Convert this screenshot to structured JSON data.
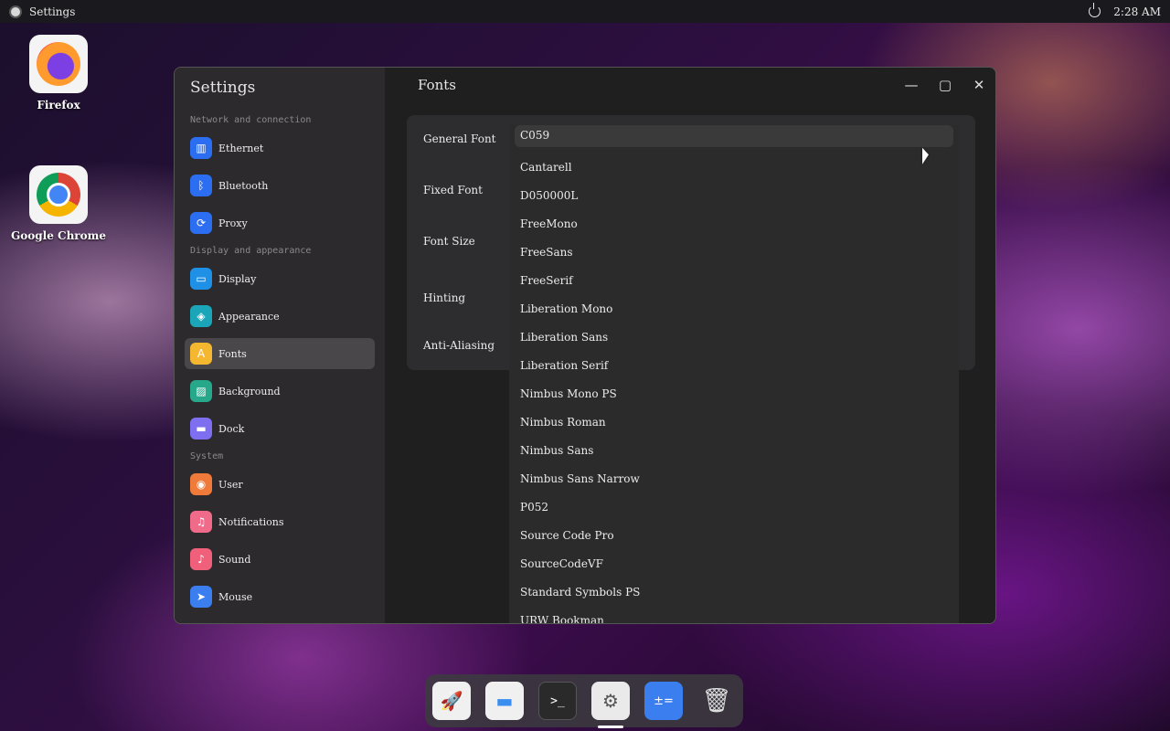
{
  "topbar": {
    "app_title": "Settings",
    "time": "2:28 AM"
  },
  "desktop": {
    "icons": [
      {
        "label": "Firefox"
      },
      {
        "label": "Google Chrome"
      }
    ]
  },
  "window": {
    "app_title": "Settings",
    "page_title": "Fonts",
    "sidebar": {
      "sections": [
        {
          "label": "Network and connection",
          "items": [
            {
              "label": "Ethernet",
              "icon": "ethernet-icon",
              "color": "#2b6ef2"
            },
            {
              "label": "Bluetooth",
              "icon": "bluetooth-icon",
              "color": "#2b6ef2"
            },
            {
              "label": "Proxy",
              "icon": "proxy-icon",
              "color": "#2b6ef2"
            }
          ]
        },
        {
          "label": "Display and appearance",
          "items": [
            {
              "label": "Display",
              "icon": "display-icon",
              "color": "#1e90e6"
            },
            {
              "label": "Appearance",
              "icon": "appearance-icon",
              "color": "#1aa6b8"
            },
            {
              "label": "Fonts",
              "icon": "fonts-icon",
              "color": "#f5b630",
              "active": true
            },
            {
              "label": "Background",
              "icon": "background-icon",
              "color": "#27a88a"
            },
            {
              "label": "Dock",
              "icon": "dock-icon",
              "color": "#7d6ff0"
            }
          ]
        },
        {
          "label": "System",
          "items": [
            {
              "label": "User",
              "icon": "user-icon",
              "color": "#f07a3a"
            },
            {
              "label": "Notifications",
              "icon": "notifications-icon",
              "color": "#f06a8a"
            },
            {
              "label": "Sound",
              "icon": "sound-icon",
              "color": "#f0607a"
            },
            {
              "label": "Mouse",
              "icon": "mouse-icon",
              "color": "#3a7ef0"
            }
          ]
        }
      ]
    },
    "settings": {
      "rows": [
        {
          "label": "General Font"
        },
        {
          "label": "Fixed Font"
        },
        {
          "label": "Font Size"
        },
        {
          "label": "Hinting"
        },
        {
          "label": "Anti-Aliasing"
        }
      ]
    },
    "font_dropdown": {
      "selected": "C059",
      "options": [
        "C059",
        "Cantarell",
        "D050000L",
        "FreeMono",
        "FreeSans",
        "FreeSerif",
        "Liberation Mono",
        "Liberation Sans",
        "Liberation Serif",
        "Nimbus Mono PS",
        "Nimbus Roman",
        "Nimbus Sans",
        "Nimbus Sans Narrow",
        "P052",
        "Source Code Pro",
        "SourceCodeVF",
        "Standard Symbols PS",
        "URW Bookman"
      ]
    }
  },
  "dock": {
    "items": [
      {
        "name": "launcher-icon"
      },
      {
        "name": "files-icon"
      },
      {
        "name": "terminal-icon"
      },
      {
        "name": "settings-icon",
        "running": true
      },
      {
        "name": "calculator-icon"
      },
      {
        "name": "trash-icon"
      }
    ]
  }
}
